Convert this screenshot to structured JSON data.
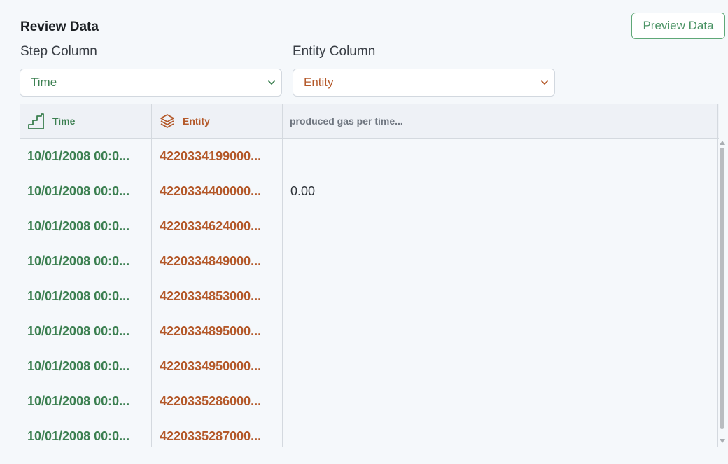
{
  "header": {
    "title": "Review Data",
    "preview_button": "Preview Data"
  },
  "step_column": {
    "label": "Step Column",
    "selected": "Time"
  },
  "entity_column": {
    "label": "Entity Column",
    "selected": "Entity"
  },
  "table": {
    "columns": [
      "Time",
      "Entity",
      "produced gas per time..."
    ],
    "rows": [
      [
        "10/01/2008 00:0...",
        "4220334199000...",
        ""
      ],
      [
        "10/01/2008 00:0...",
        "4220334400000...",
        "0.00"
      ],
      [
        "10/01/2008 00:0...",
        "4220334624000...",
        ""
      ],
      [
        "10/01/2008 00:0...",
        "4220334849000...",
        ""
      ],
      [
        "10/01/2008 00:0...",
        "4220334853000...",
        ""
      ],
      [
        "10/01/2008 00:0...",
        "4220334895000...",
        ""
      ],
      [
        "10/01/2008 00:0...",
        "4220334950000...",
        ""
      ],
      [
        "10/01/2008 00:0...",
        "4220335286000...",
        ""
      ],
      [
        "10/01/2008 00:0...",
        "4220335287000...",
        ""
      ]
    ]
  },
  "icons": {
    "time_column": "step-stairs-icon",
    "entity_column": "layers-stack-icon",
    "dropdown": "chevron-down-icon"
  },
  "colors": {
    "step_green": "#3b7f50",
    "entity_orange": "#b4592a",
    "button_green": "#4a9364"
  }
}
